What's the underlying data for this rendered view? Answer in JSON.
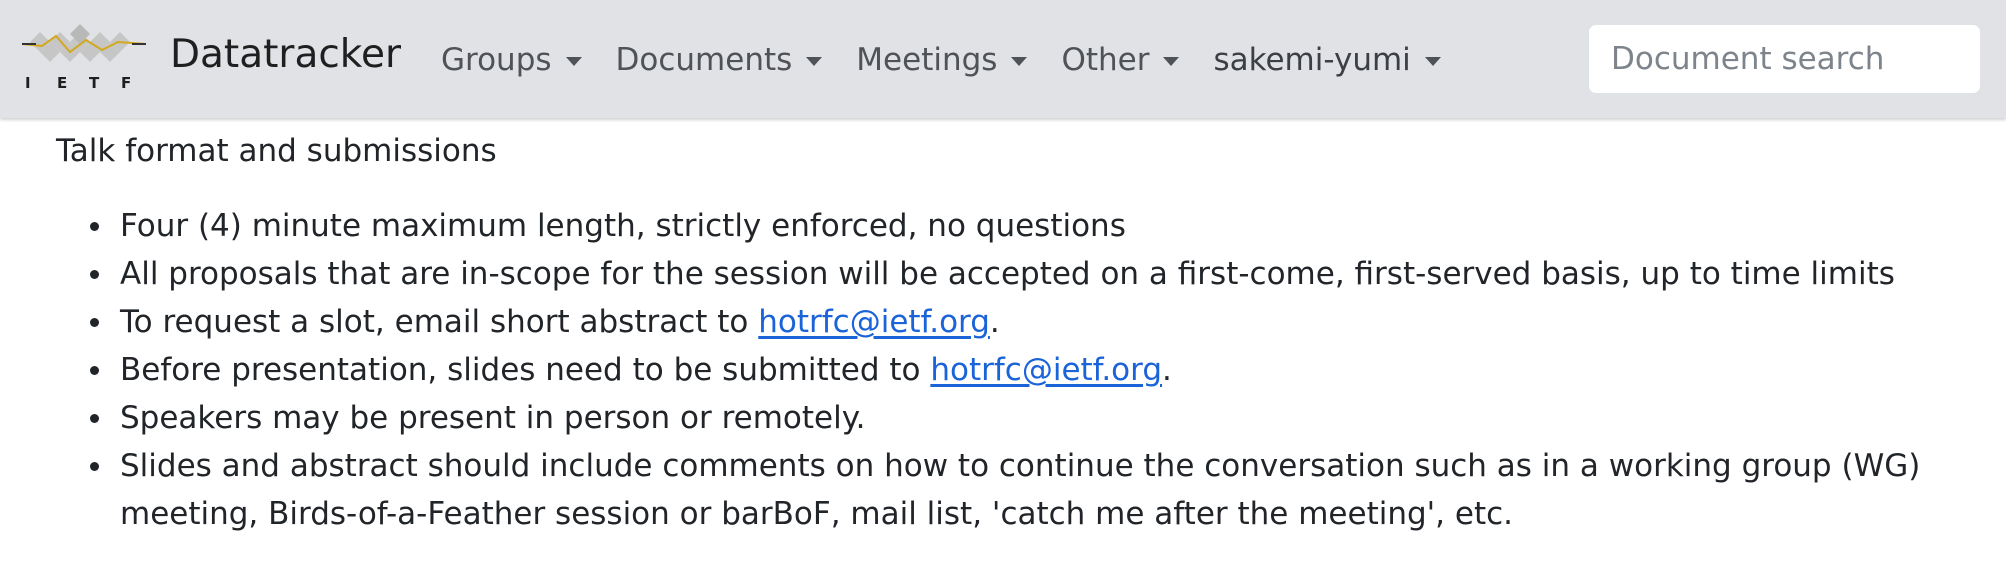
{
  "brand": {
    "logo_text": "IETF",
    "title": "Datatracker"
  },
  "nav": {
    "items": [
      {
        "label": "Groups"
      },
      {
        "label": "Documents"
      },
      {
        "label": "Meetings"
      },
      {
        "label": "Other"
      },
      {
        "label": "sakemi-yumi"
      }
    ]
  },
  "search": {
    "placeholder": "Document search"
  },
  "main": {
    "heading": "Talk format and submissions",
    "list": {
      "item1": "Four (4) minute maximum length, strictly enforced, no questions",
      "item2": "All proposals that are in-scope for the session will be accepted on a first-come, first-served basis, up to time limits",
      "item3_prefix": "To request a slot, email short abstract to ",
      "item3_link": "hotrfc@ietf.org",
      "item3_suffix": ".",
      "item4_prefix": "Before presentation, slides need to be submitted to ",
      "item4_link": "hotrfc@ietf.org",
      "item4_suffix": ".",
      "item5": "Speakers may be present in person or remotely.",
      "item6": "Slides and abstract should include comments on how to continue the conversation such as in a working group (WG) meeting, Birds-of-a-Feather session or barBoF, mail list, 'catch me after the meeting', etc."
    }
  },
  "colors": {
    "navbar_bg": "#e0e2e6",
    "link": "#1b63d8",
    "text": "#212529",
    "logo_gold": "#d2a81f",
    "logo_gray": "#c6c6c6"
  }
}
